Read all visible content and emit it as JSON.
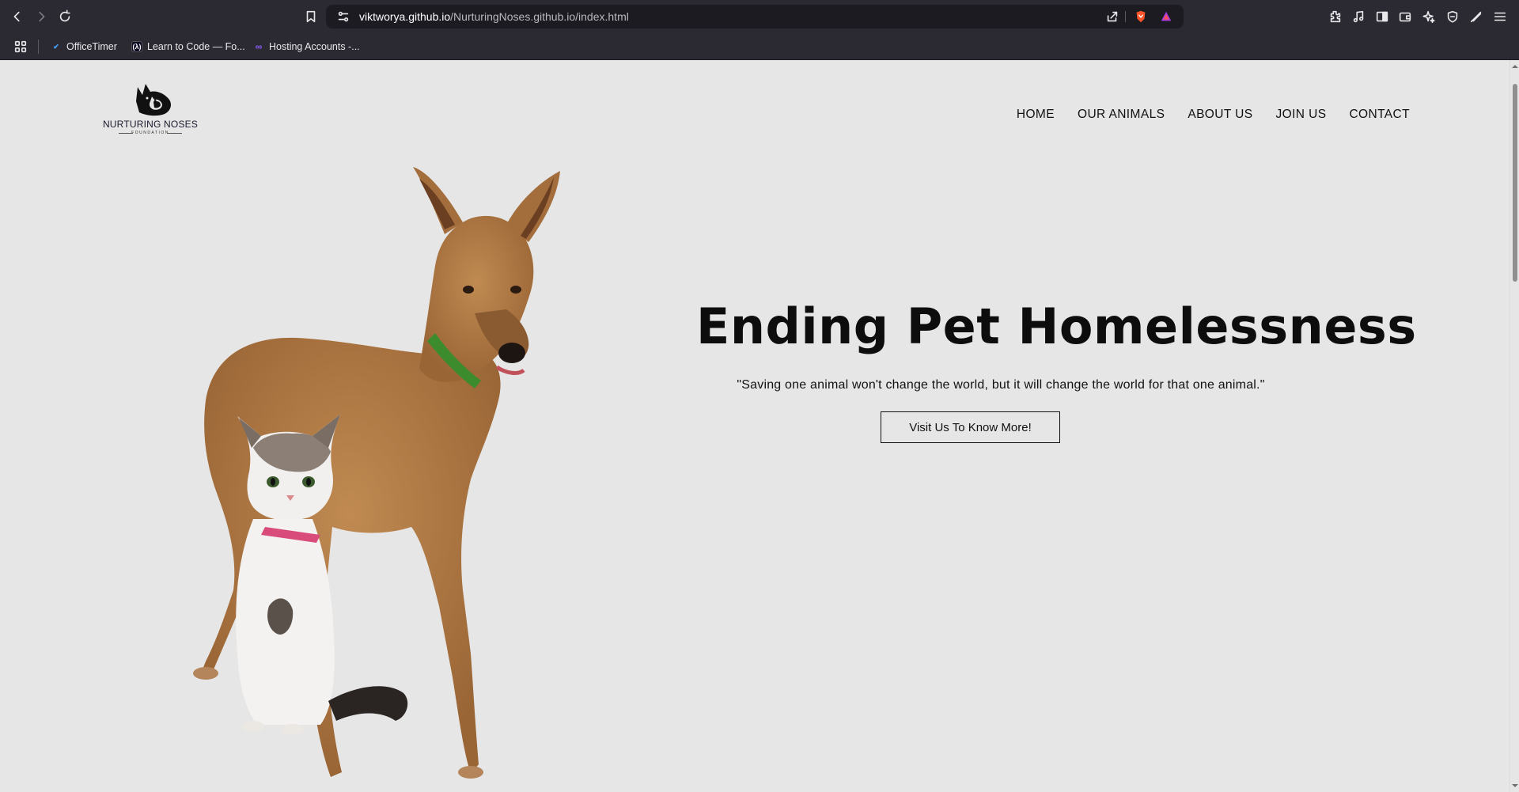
{
  "browser": {
    "url_host": "viktworya.github.io",
    "url_path": "/NurturingNoses.github.io/index.html",
    "bookmarks": [
      {
        "label": "OfficeTimer"
      },
      {
        "label": "Learn to Code — Fo..."
      },
      {
        "label": "Hosting Accounts -..."
      }
    ]
  },
  "site": {
    "logo_name": "NURTURING NOSES",
    "logo_sub": "FOUNDATION",
    "nav": [
      "HOME",
      "OUR ANIMALS",
      "ABOUT US",
      "JOIN US",
      "CONTACT"
    ]
  },
  "hero": {
    "title": "Ending Pet Homelessness",
    "quote": "\"Saving one animal won't change the world, but it will change the world for that one animal.\"",
    "button": "Visit Us To Know More!"
  },
  "colors": {
    "page_bg": "#e6e6e6",
    "chrome_bg": "#2b2a33",
    "text": "#111111",
    "dog_fur": "#b07a45",
    "collar_green": "#3c8c2e",
    "collar_pink": "#d94b7a"
  }
}
